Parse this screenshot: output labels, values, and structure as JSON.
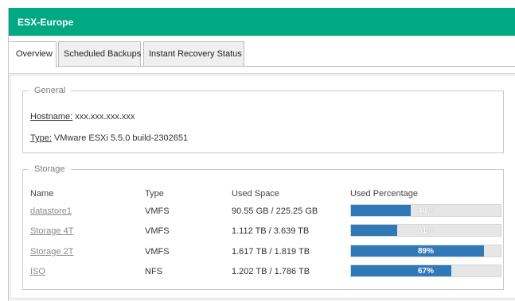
{
  "window": {
    "title": "ESX-Europe"
  },
  "tabs": [
    {
      "label": "Overview",
      "active": true
    },
    {
      "label": "Scheduled Backups",
      "active": false
    },
    {
      "label": "Instant Recovery Status",
      "active": false
    }
  ],
  "general": {
    "legend": "General",
    "hostname_label": "Hostname:",
    "hostname_value": "xxx.xxx.xxx.xxx",
    "type_label": "Type:",
    "type_value": "VMware ESXi 5.5.0 build-2302651"
  },
  "storage": {
    "legend": "Storage",
    "columns": [
      "Name",
      "Type",
      "Used Space",
      "Used Percentage"
    ],
    "rows": [
      {
        "name": "datastore1",
        "type": "VMFS",
        "used": "90.55 GB / 225.25 GB",
        "pct_label": "40%",
        "pct": 0.4
      },
      {
        "name": "Storage 4T",
        "type": "VMFS",
        "used": "1.112 TB / 3.639 TB",
        "pct_label": "31%",
        "pct": 0.31
      },
      {
        "name": "Storage 2T",
        "type": "VMFS",
        "used": "1.617 TB / 1.819 TB",
        "pct_label": "89%",
        "pct": 0.89
      },
      {
        "name": "ISO",
        "type": "NFS",
        "used": "1.202 TB / 1.786 TB",
        "pct_label": "67%",
        "pct": 0.67
      }
    ]
  },
  "colors": {
    "titlebar": "#01a982",
    "bar_fill": "#2f79b9",
    "bar_track": "#e6e6e6"
  }
}
